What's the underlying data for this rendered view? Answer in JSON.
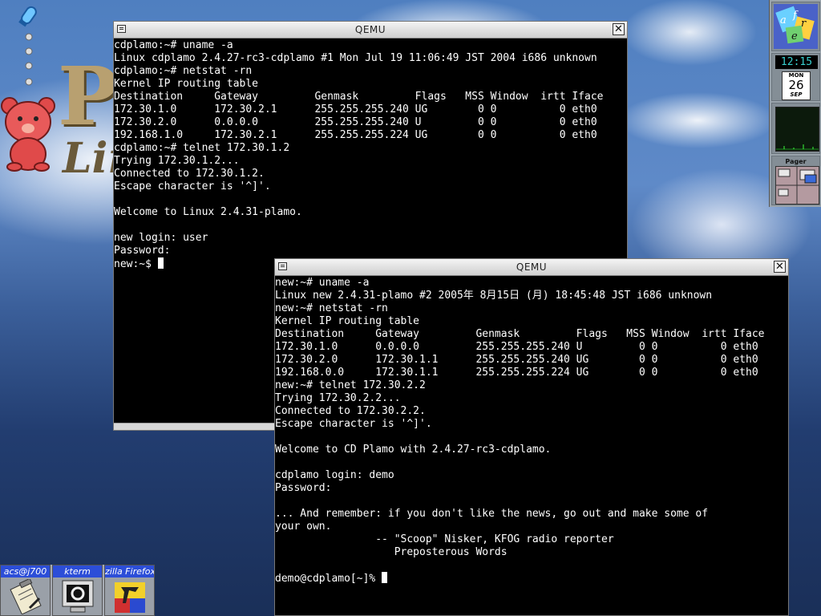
{
  "desktop": {
    "logo_letter": "P",
    "logo_word": "Lin"
  },
  "window1": {
    "title": "QEMU",
    "lines": [
      "cdplamo:~# uname -a",
      "Linux cdplamo 2.4.27-rc3-cdplamo #1 Mon Jul 19 11:06:49 JST 2004 i686 unknown",
      "cdplamo:~# netstat -rn",
      "Kernel IP routing table",
      "Destination     Gateway         Genmask         Flags   MSS Window  irtt Iface",
      "172.30.1.0      172.30.2.1      255.255.255.240 UG        0 0          0 eth0",
      "172.30.2.0      0.0.0.0         255.255.255.240 U         0 0          0 eth0",
      "192.168.1.0     172.30.2.1      255.255.255.224 UG        0 0          0 eth0",
      "cdplamo:~# telnet 172.30.1.2",
      "Trying 172.30.1.2...",
      "Connected to 172.30.1.2.",
      "Escape character is '^]'.",
      "",
      "Welcome to Linux 2.4.31-plamo.",
      "",
      "new login: user",
      "Password:"
    ],
    "prompt": "new:~$ "
  },
  "window2": {
    "title": "QEMU",
    "lines": [
      "new:~# uname -a",
      "Linux new 2.4.31-plamo #2 2005年 8月15日 (月) 18:45:48 JST i686 unknown",
      "new:~# netstat -rn",
      "Kernel IP routing table",
      "Destination     Gateway         Genmask         Flags   MSS Window  irtt Iface",
      "172.30.1.0      0.0.0.0         255.255.255.240 U         0 0          0 eth0",
      "172.30.2.0      172.30.1.1      255.255.255.240 UG        0 0          0 eth0",
      "192.168.0.0     172.30.1.1      255.255.255.224 UG        0 0          0 eth0",
      "new:~# telnet 172.30.2.2",
      "Trying 172.30.2.2...",
      "Connected to 172.30.2.2.",
      "Escape character is '^]'.",
      "",
      "Welcome to CD Plamo with 2.4.27-rc3-cdplamo.",
      "",
      "cdplamo login: demo",
      "Password:",
      "",
      "... And remember: if you don't like the news, go out and make some of",
      "your own.",
      "                -- \"Scoop\" Nisker, KFOG radio reporter",
      "                   Preposterous Words",
      ""
    ],
    "prompt": "demo@cdplamo[~]% "
  },
  "dock": {
    "time": "12:15",
    "cal_dow": "MON",
    "cal_day": "26",
    "cal_month": "SEP",
    "pager_label": "Pager"
  },
  "wharf": {
    "items": [
      {
        "label": "acs@j700",
        "icon": "clipboard-icon"
      },
      {
        "label": "kterm",
        "icon": "monitor-icon"
      },
      {
        "label": "zilla Firefox",
        "icon": "firefox-icon"
      }
    ]
  }
}
